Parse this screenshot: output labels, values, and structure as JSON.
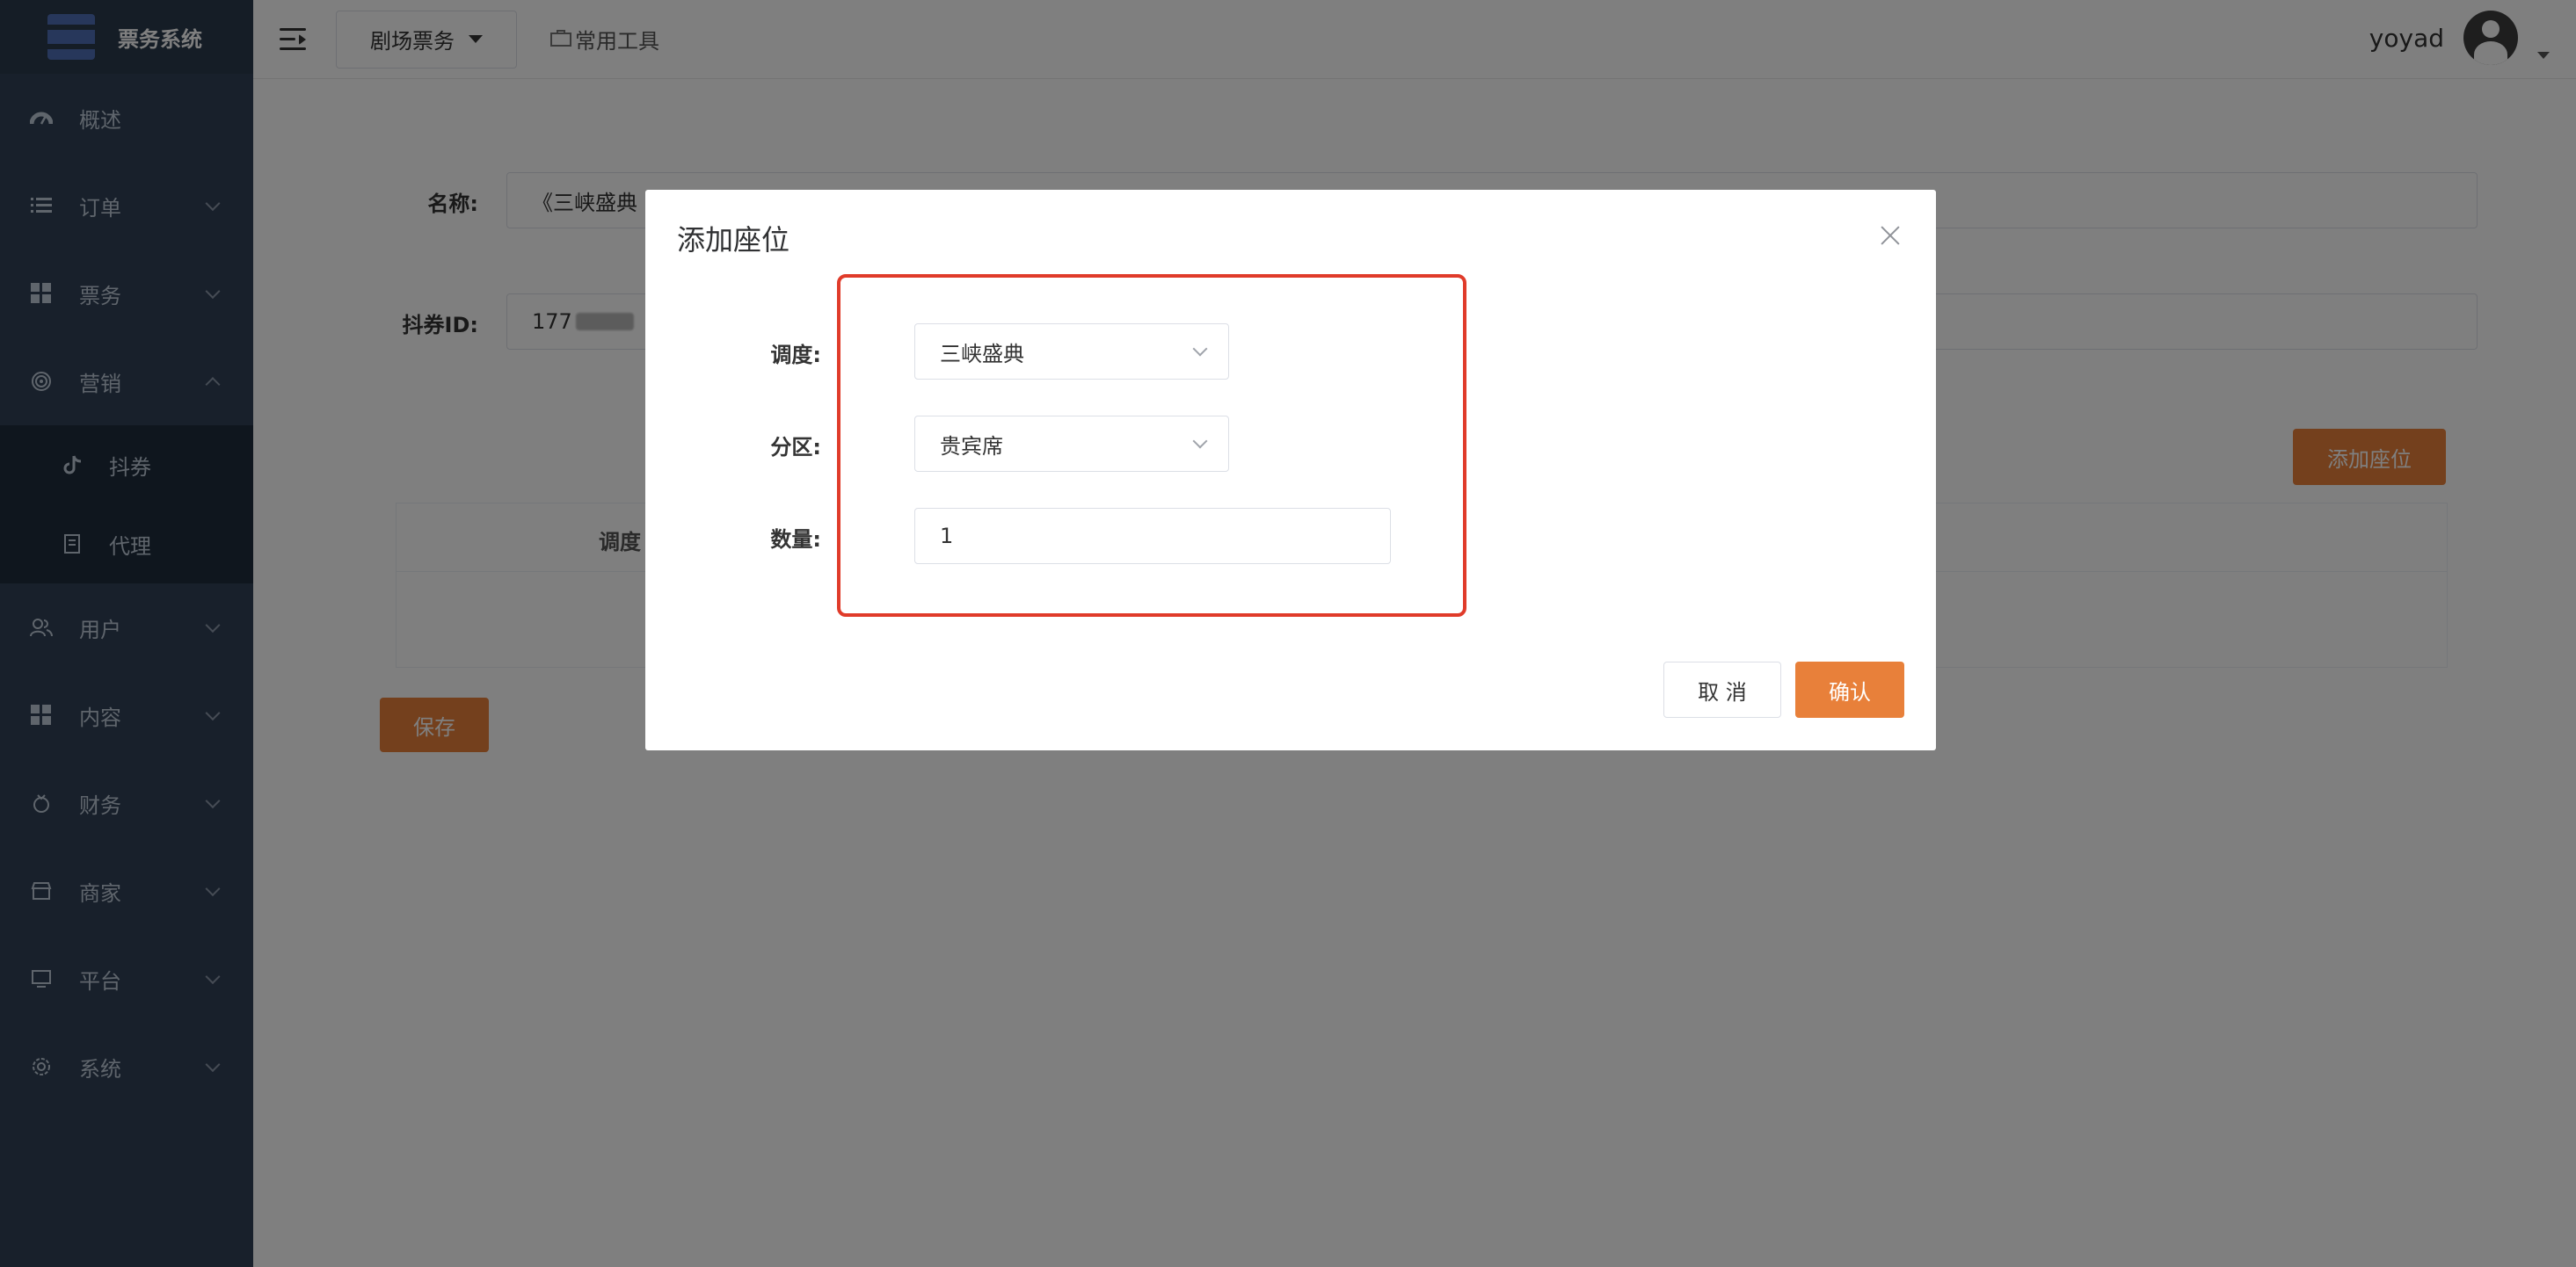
{
  "sidebar": {
    "title": "票务系统",
    "items": [
      {
        "label": "概述",
        "icon": "gauge-icon"
      },
      {
        "label": "订单",
        "icon": "list-icon"
      },
      {
        "label": "票务",
        "icon": "grid-icon"
      },
      {
        "label": "营销",
        "icon": "target-icon",
        "expanded": true
      },
      {
        "label": "抖券",
        "icon": "tiktok-icon",
        "sub": true
      },
      {
        "label": "代理",
        "icon": "document-icon",
        "sub": true
      },
      {
        "label": "用户",
        "icon": "users-icon"
      },
      {
        "label": "内容",
        "icon": "grid-icon"
      },
      {
        "label": "财务",
        "icon": "money-icon"
      },
      {
        "label": "商家",
        "icon": "shop-icon"
      },
      {
        "label": "平台",
        "icon": "monitor-icon"
      },
      {
        "label": "系统",
        "icon": "gear-icon"
      }
    ]
  },
  "header": {
    "tab_label": "剧场票务",
    "tools_label": "常用工具",
    "username": "yoyad"
  },
  "form": {
    "name_label": "名称:",
    "name_value": "《三峡盛典",
    "coupon_label": "抖券ID:",
    "coupon_value": "177",
    "add_seat_button": "添加座位",
    "table_header": "调度",
    "save_button": "保存"
  },
  "modal": {
    "title": "添加座位",
    "schedule_label": "调度:",
    "schedule_value": "三峡盛典",
    "zone_label": "分区:",
    "zone_value": "贵宾席",
    "quantity_label": "数量:",
    "quantity_value": "1",
    "cancel_button": "取 消",
    "confirm_button": "确认"
  },
  "colors": {
    "sidebar_bg": "#304156",
    "accent": "#e8803a",
    "highlight_border": "#e03b2a"
  }
}
